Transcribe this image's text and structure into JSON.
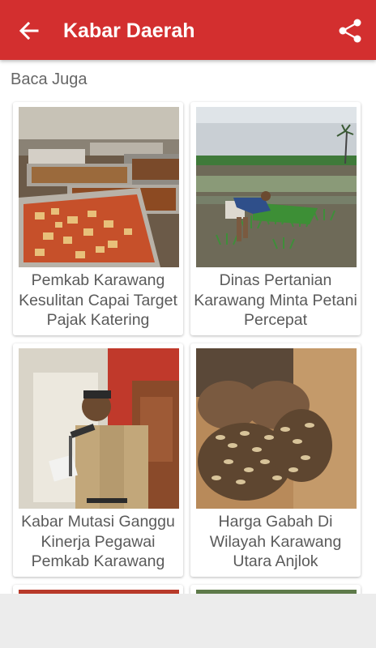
{
  "appbar": {
    "title": "Kabar Daerah",
    "back_icon": "arrow-back-icon",
    "share_icon": "share-icon",
    "color": "#d32f2f"
  },
  "section": {
    "label": "Baca Juga"
  },
  "articles": [
    {
      "title": "Pemkab Karawang Kesulitan Capai Target Pajak Katering",
      "image": "catering-buffet-trays"
    },
    {
      "title": "Dinas Pertanian Karawang Minta Petani Percepat",
      "image": "farmer-planting-rice-field"
    },
    {
      "title": "Kabar Mutasi Ganggu Kinerja Pegawai Pemkab Karawang",
      "image": "official-speaking-at-microphone"
    },
    {
      "title": "Harga Gabah Di Wilayah Karawang Utara Anjlok",
      "image": "hands-holding-rice-grain"
    }
  ]
}
